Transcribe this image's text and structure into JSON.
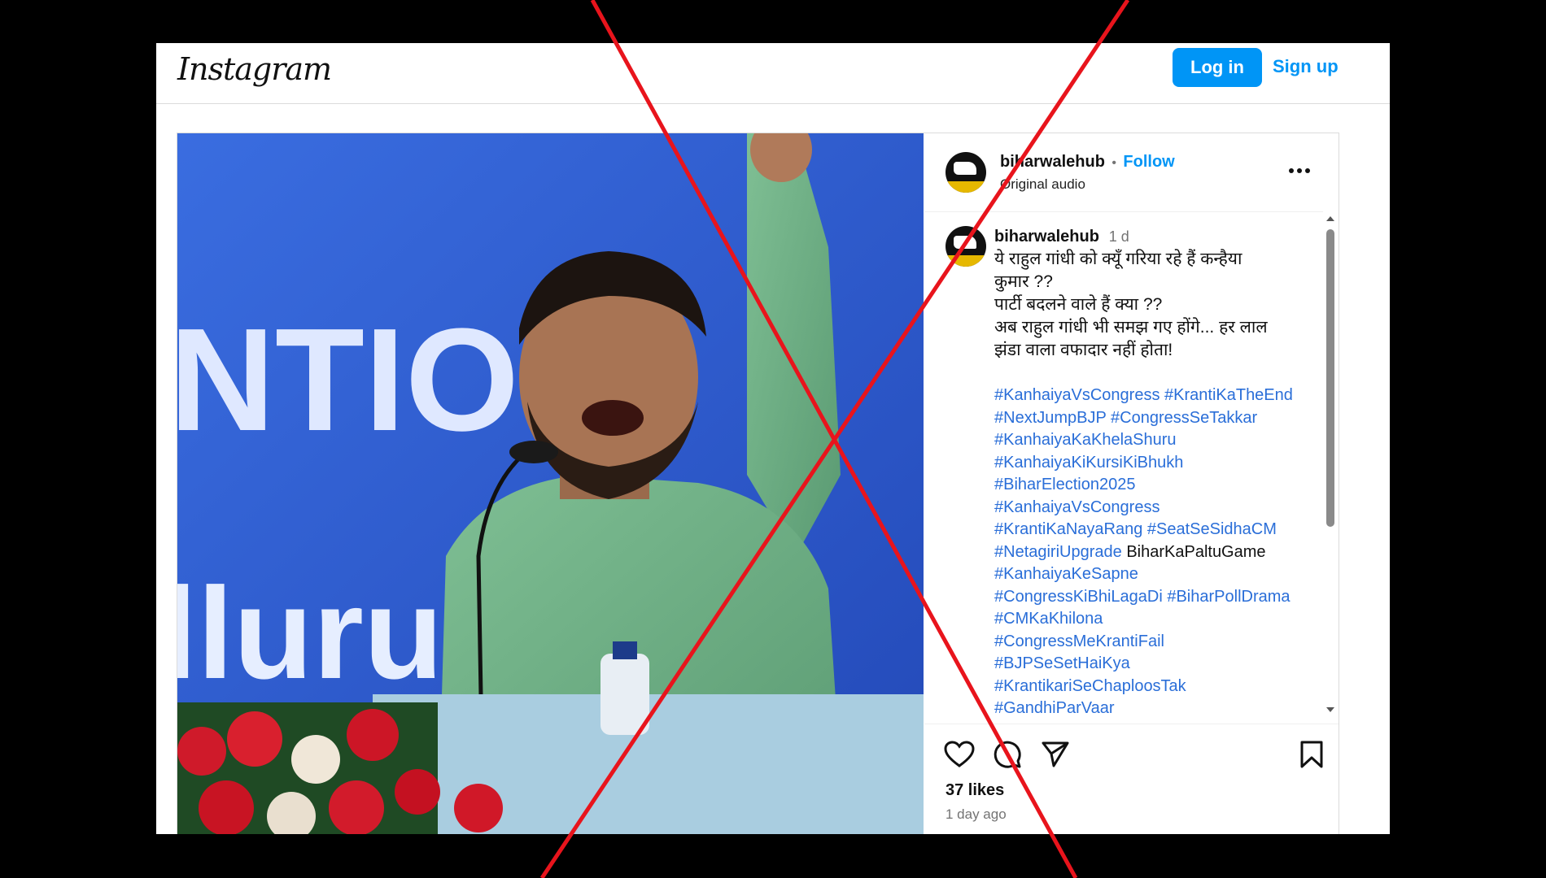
{
  "topbar": {
    "logo_text": "Instagram",
    "login_label": "Log in",
    "signup_label": "Sign up",
    "accent_color": "#0095f6"
  },
  "post": {
    "author": "biharwalehub",
    "separator": "•",
    "follow_label": "Follow",
    "audio_label": "Original audio",
    "more_icon": "more-options-icon",
    "caption": {
      "author": "biharwalehub",
      "time": "1 d",
      "lines": [
        "ये राहुल गांधी को क्यूँ गरिया रहे हैं कन्हैया",
        "कुमार ??",
        "पार्टी बदलने वाले हैं क्या ??",
        "अब राहुल गांधी भी समझ गए होंगे... हर लाल",
        "झंडा वाला वफादार नहीं होता!"
      ],
      "hashtag_lines": [
        "#KanhaiyaVsCongress #KrantiKaTheEnd",
        "#NextJumpBJP #CongressSeTakkar",
        "#KanhaiyaKaKhelaShuru",
        "#KanhaiyaKiKursiKiBhukh",
        "#BiharElection2025",
        "#KanhaiyaVsCongress",
        "#KrantiKaNayaRang #SeatSeSidhaCM"
      ],
      "hashtag_mixed": {
        "tag": "#NetagiriUpgrade",
        "plain": " BiharKaPaltuGame"
      },
      "hashtag_lines_after": [
        "#KanhaiyaKeSapne",
        "#CongressKiBhiLagaDi #BiharPollDrama",
        "#CMKaKhilona",
        "#CongressMeKrantiFail",
        "#BJPSeSetHaiKya",
        "#KrantikariSeChaploosTak",
        "#GandhiParVaar"
      ]
    },
    "likes": "37 likes",
    "ago": "1 day ago",
    "icons": [
      "heart-icon",
      "comment-icon",
      "share-icon",
      "bookmark-icon"
    ]
  },
  "media": {
    "banner_text_1": "NTIO",
    "banner_text_2": "lluru"
  },
  "overlay": {
    "cross_color": "#e8141c"
  }
}
